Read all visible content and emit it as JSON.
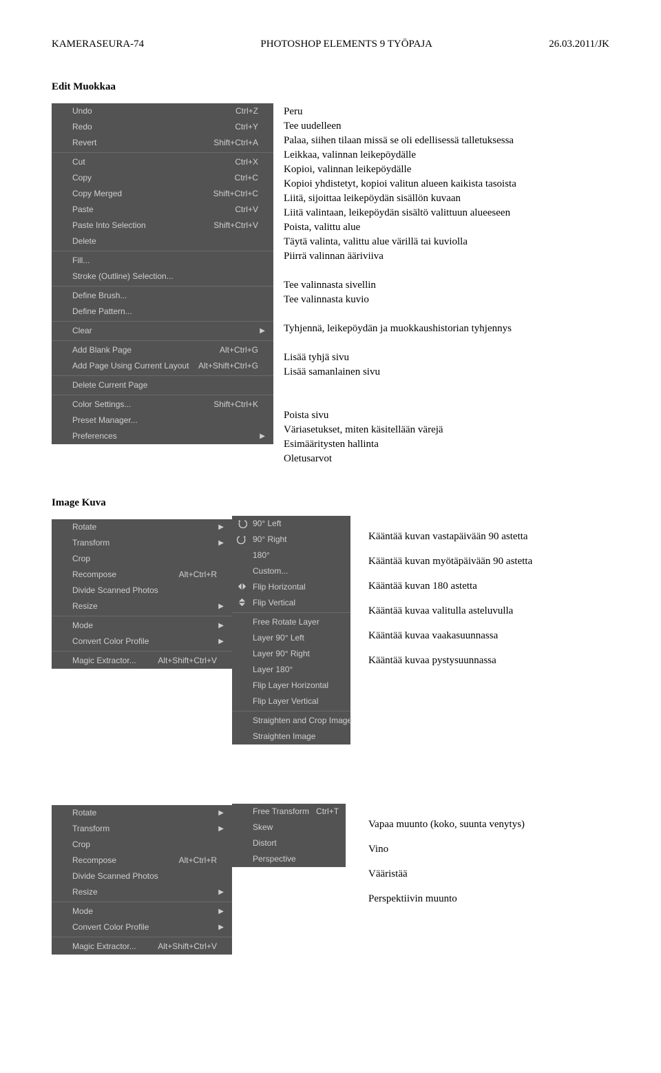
{
  "header": {
    "left": "KAMERASEURA-74",
    "center": "PHOTOSHOP ELEMENTS 9 TYÖPAJA",
    "right": "26.03.2011/JK"
  },
  "edit": {
    "title": "Edit Muokkaa",
    "menu": [
      {
        "label": "Undo",
        "sc": "Ctrl+Z"
      },
      {
        "label": "Redo",
        "sc": "Ctrl+Y"
      },
      {
        "label": "Revert",
        "sc": "Shift+Ctrl+A"
      },
      {
        "sep": 1
      },
      {
        "label": "Cut",
        "sc": "Ctrl+X"
      },
      {
        "label": "Copy",
        "sc": "Ctrl+C"
      },
      {
        "label": "Copy Merged",
        "sc": "Shift+Ctrl+C"
      },
      {
        "label": "Paste",
        "sc": "Ctrl+V"
      },
      {
        "label": "Paste Into Selection",
        "sc": "Shift+Ctrl+V"
      },
      {
        "label": "Delete"
      },
      {
        "sep": 1
      },
      {
        "label": "Fill..."
      },
      {
        "label": "Stroke (Outline) Selection..."
      },
      {
        "sep": 1
      },
      {
        "label": "Define Brush..."
      },
      {
        "label": "Define Pattern..."
      },
      {
        "sep": 1
      },
      {
        "label": "Clear",
        "arrow": 1
      },
      {
        "sep": 1
      },
      {
        "label": "Add Blank Page",
        "sc": "Alt+Ctrl+G"
      },
      {
        "label": "Add Page Using Current Layout",
        "sc": "Alt+Shift+Ctrl+G"
      },
      {
        "sep": 1
      },
      {
        "label": "Delete Current Page"
      },
      {
        "sep": 1
      },
      {
        "label": "Color Settings...",
        "sc": "Shift+Ctrl+K"
      },
      {
        "label": "Preset Manager..."
      },
      {
        "label": "Preferences",
        "arrow": 1
      }
    ],
    "desc": [
      "Peru",
      "Tee uudelleen",
      "Palaa, siihen tilaan missä se oli edellisessä talletuksessa",
      "Leikkaa, valinnan leikepöydälle",
      "Kopioi, valinnan leikepöydälle",
      "Kopioi yhdistetyt, kopioi valitun alueen kaikista tasoista",
      "Liitä, sijoittaa leikepöydän sisällön kuvaan",
      "Liitä valintaan, leikepöydän sisältö valittuun alueeseen",
      "Poista, valittu alue",
      "Täytä valinta, valittu alue värillä tai kuviolla",
      "Piirrä valinnan ääriviiva",
      "",
      "Tee valinnasta sivellin",
      "Tee valinnasta kuvio",
      "",
      "Tyhjennä, leikepöydän ja muokkaushistorian tyhjennys",
      "",
      "Lisää tyhjä sivu",
      "Lisää samanlainen sivu",
      "",
      "",
      "Poista sivu",
      "Väriasetukset, miten käsitellään värejä",
      "Esimääritysten hallinta",
      "Oletusarvot"
    ]
  },
  "image": {
    "title": "Image Kuva",
    "main": [
      {
        "label": "Rotate",
        "arrow": 1
      },
      {
        "label": "Transform",
        "arrow": 1
      },
      {
        "label": "Crop"
      },
      {
        "label": "Recompose",
        "sc": "Alt+Ctrl+R"
      },
      {
        "label": "Divide Scanned Photos"
      },
      {
        "label": "Resize",
        "arrow": 1
      },
      {
        "sep": 1
      },
      {
        "label": "Mode",
        "arrow": 1
      },
      {
        "label": "Convert Color Profile",
        "arrow": 1
      },
      {
        "sep": 1
      },
      {
        "label": "Magic Extractor...",
        "sc": "Alt+Shift+Ctrl+V"
      }
    ],
    "rotate": [
      {
        "label": "90° Left",
        "ico": "l"
      },
      {
        "label": "90° Right",
        "ico": "r"
      },
      {
        "label": "180°"
      },
      {
        "label": "Custom..."
      },
      {
        "label": "Flip Horizontal",
        "ico": "h"
      },
      {
        "label": "Flip Vertical",
        "ico": "v"
      },
      {
        "sep": 1
      },
      {
        "label": "Free Rotate Layer"
      },
      {
        "label": "Layer 90° Left"
      },
      {
        "label": "Layer 90° Right"
      },
      {
        "label": "Layer 180°"
      },
      {
        "label": "Flip Layer Horizontal"
      },
      {
        "label": "Flip Layer Vertical"
      },
      {
        "sep": 1
      },
      {
        "label": "Straighten and Crop Image"
      },
      {
        "label": "Straighten Image"
      }
    ],
    "transform": [
      {
        "label": "Free Transform",
        "sc": "Ctrl+T"
      },
      {
        "label": "Skew"
      },
      {
        "label": "Distort"
      },
      {
        "label": "Perspective"
      }
    ],
    "desc1": [
      "Kääntää kuvan vastapäivään 90 astetta",
      "Kääntää kuvan myötäpäivään 90 astetta",
      "Kääntää kuvan 180 astetta",
      "Kääntää kuvaa valitulla asteluvulla",
      "Kääntää kuvaa vaakasuunnassa",
      "Kääntää kuvaa pystysuunnassa"
    ],
    "desc2": [
      "Vapaa muunto (koko, suunta venytys)",
      "Vino",
      "Vääristää",
      "Perspektiivin muunto"
    ]
  }
}
